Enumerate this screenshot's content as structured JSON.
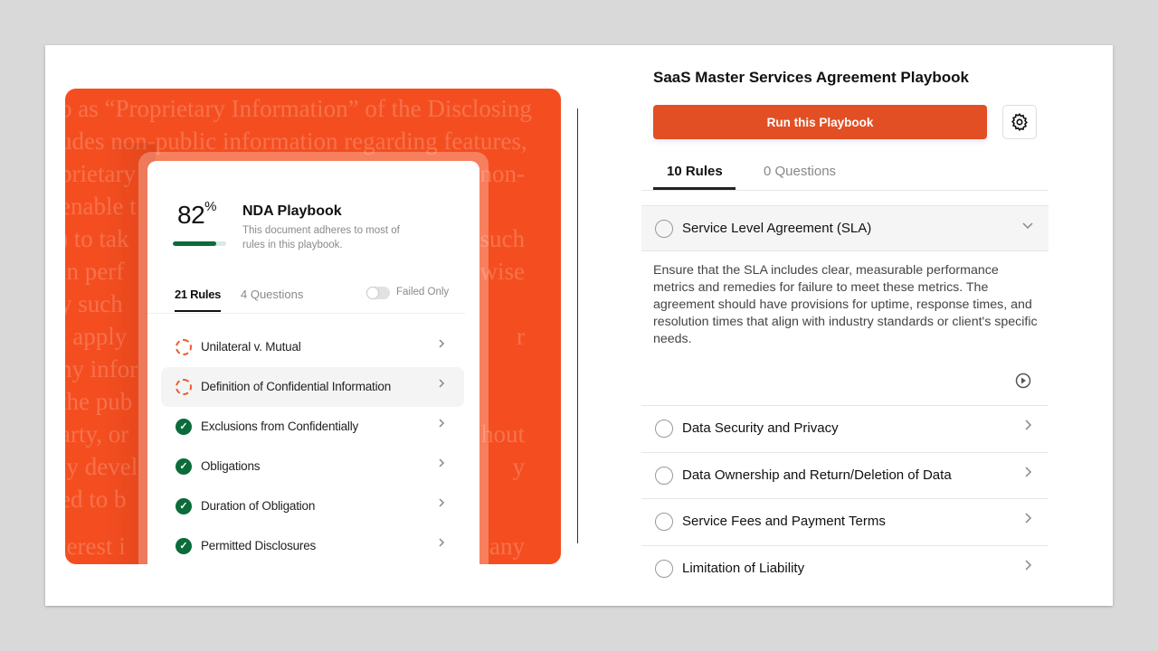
{
  "background_text": [
    {
      "left": "o as “Proprietary Information” of the Disclosing",
      "right": ""
    },
    {
      "left": "udes non-public information regarding features,",
      "right": ""
    },
    {
      "left": "prietary",
      "right": "non-"
    },
    {
      "left": "enable t",
      "right": ""
    },
    {
      "left": ") to tak",
      "right": "such"
    },
    {
      "left": " in perf",
      "right": "wise"
    },
    {
      "left": "y such",
      "right": ""
    },
    {
      "left": "t apply",
      "right": "r"
    },
    {
      "left": "ny infor",
      "right": ""
    },
    {
      "left": "the pub",
      "right": ""
    },
    {
      "left": "arty, or",
      "right": "hout"
    },
    {
      "left": "ly devel",
      "right": "y"
    },
    {
      "left": "ed to b",
      "right": ""
    },
    {
      "left": "terest i",
      "right": "any"
    }
  ],
  "nda_card": {
    "score": "82",
    "score_unit": "%",
    "score_value": 82,
    "title": "NDA Playbook",
    "subtitle": "This document adheres to most of rules in this playbook.",
    "tabs": [
      "21 Rules",
      "4 Questions"
    ],
    "filter_label": "Failed Only",
    "filter_on": false,
    "items": [
      {
        "label": "Unilateral v. Mutual",
        "status": "failed"
      },
      {
        "label": "Definition of Confidential Information",
        "status": "failed",
        "highlighted": true
      },
      {
        "label": "Exclusions from Confidentially",
        "status": "passed"
      },
      {
        "label": "Obligations",
        "status": "passed"
      },
      {
        "label": "Duration of Obligation",
        "status": "passed"
      },
      {
        "label": "Permitted Disclosures",
        "status": "passed"
      }
    ]
  },
  "playbook": {
    "title": "SaaS Master Services Agreement Playbook",
    "run_label": "Run this Playbook",
    "tabs": [
      "10 Rules",
      "0 Questions"
    ],
    "expanded": {
      "label": "Service Level Agreement (SLA)",
      "description": "Ensure that the SLA includes clear, measurable performance metrics and remedies for failure to meet these metrics. The agreement should have provisions for uptime, response times, and resolution times that align with industry standards or client's specific needs."
    },
    "rules": [
      "Data Security and Privacy",
      "Data Ownership and Return/Deletion of Data",
      "Service Fees and Payment Terms",
      "Limitation of Liability"
    ]
  },
  "colors": {
    "accent": "#e24f24",
    "panel": "#f44e20",
    "pass": "#0b6b3a"
  }
}
